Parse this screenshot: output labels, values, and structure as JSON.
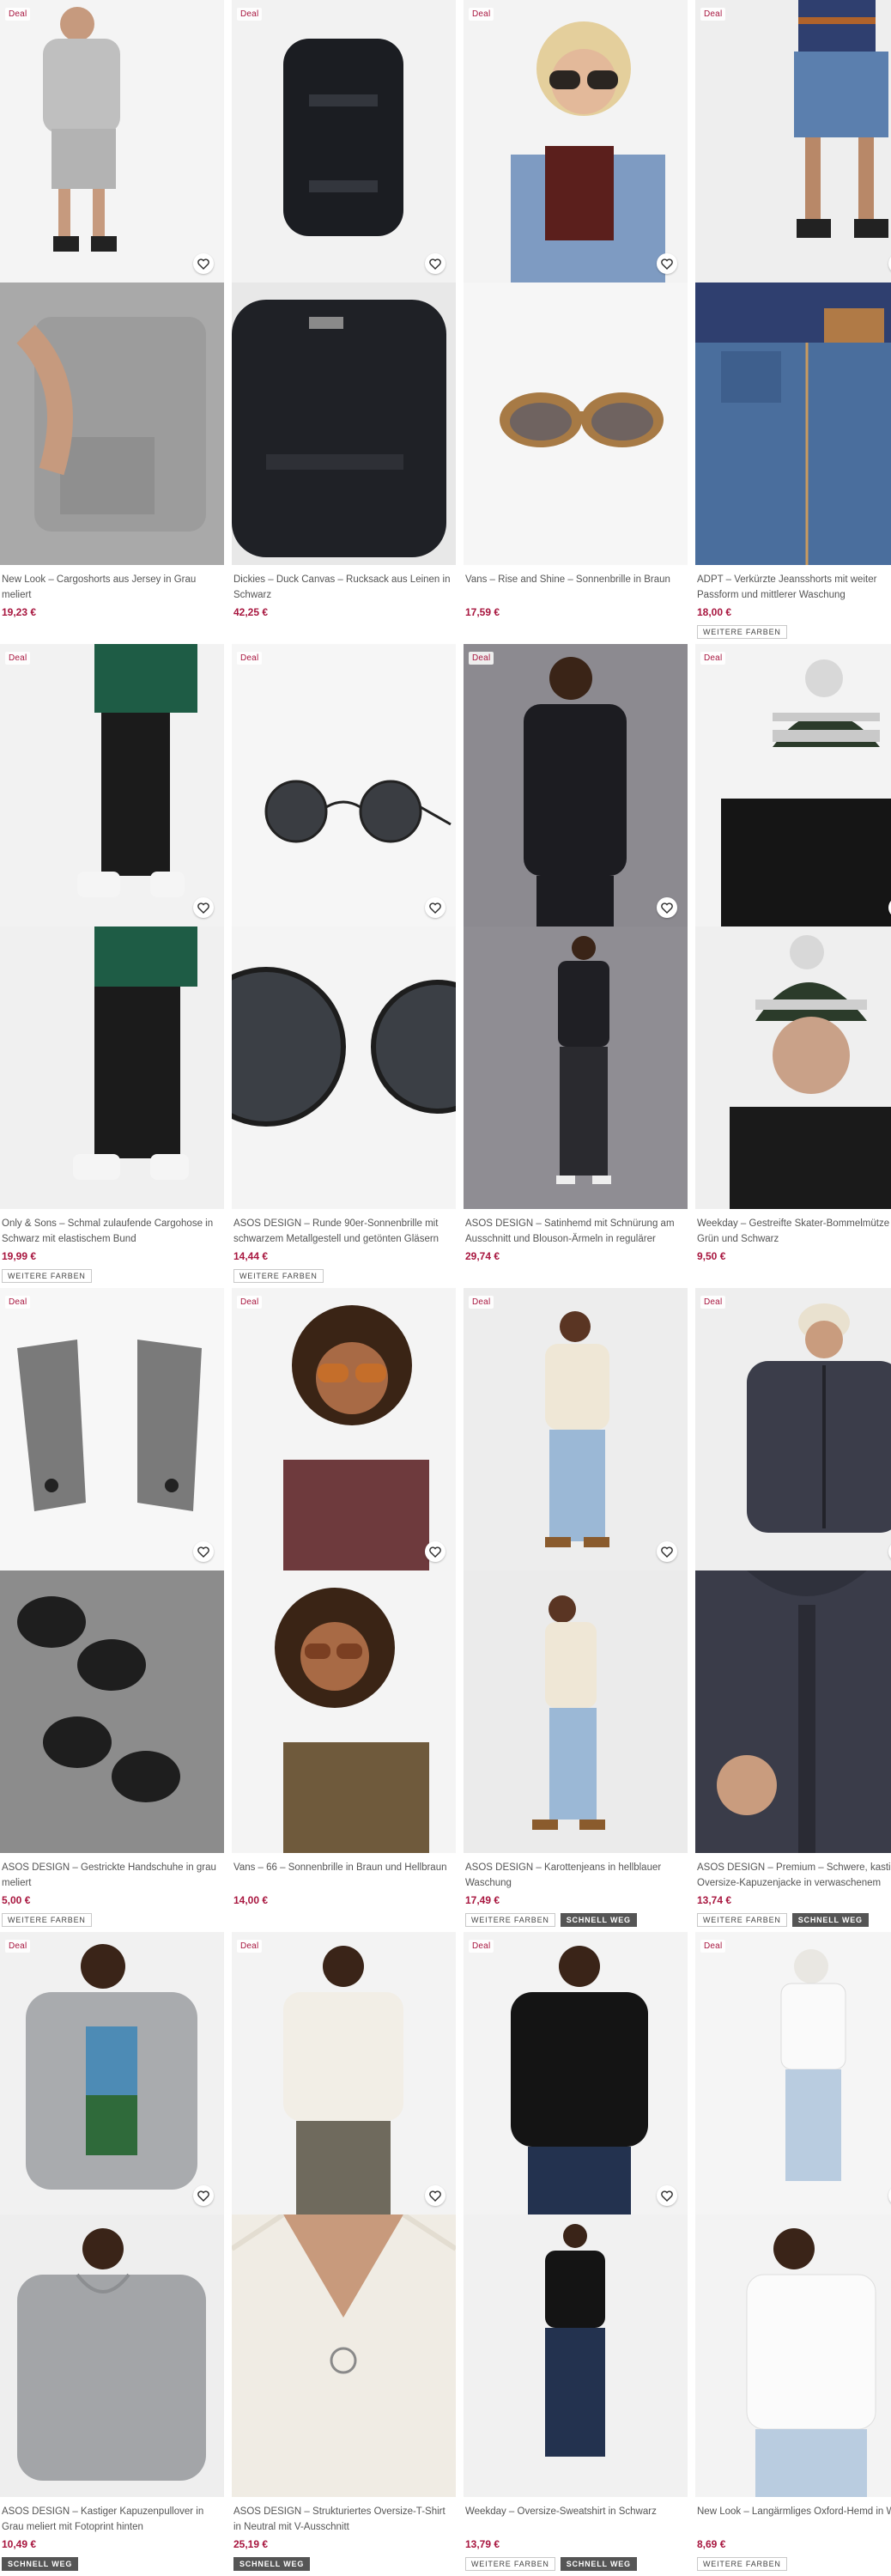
{
  "colors": {
    "price": "#a8163f",
    "deal": "#a8163f",
    "tag_dark": "#555555"
  },
  "icons": {
    "wishlist": "heart-icon"
  },
  "products": [
    {
      "deal": "Deal",
      "title": "New Look – Cargoshorts aus Jersey in Grau meliert",
      "price": "19,23 €",
      "tags": []
    },
    {
      "deal": "Deal",
      "title": "Dickies – Duck Canvas – Rucksack aus Leinen in Schwarz",
      "price": "42,25 €",
      "tags": []
    },
    {
      "deal": "Deal",
      "title": "Vans – Rise and Shine – Sonnenbrille in Braun",
      "price": "17,59 €",
      "tags": []
    },
    {
      "deal": "Deal",
      "title": "ADPT – Verkürzte Jeansshorts mit weiter Passform und mittlerer Waschung",
      "price": "18,00 €",
      "tags": [
        "WEITERE FARBEN"
      ]
    },
    {
      "deal": "Deal",
      "title": "Only & Sons – Schmal zulaufende Cargohose in Schwarz mit elastischem Bund",
      "price": "19,99 €",
      "tags": [
        "WEITERE FARBEN"
      ]
    },
    {
      "deal": "Deal",
      "title": "ASOS DESIGN – Runde 90er-Sonnenbrille mit schwarzem Metallgestell und getönten Gläsern",
      "price": "14,44 €",
      "tags": [
        "WEITERE FARBEN"
      ]
    },
    {
      "deal": "Deal",
      "title": "ASOS DESIGN – Satinhemd mit Schnürung am Ausschnitt und Blouson-Ärmeln in regulärer Passform",
      "price": "29,74 €",
      "tags": []
    },
    {
      "deal": "Deal",
      "title": "Weekday – Gestreifte Skater-Bommelmütze in Grün und Schwarz",
      "price": "9,50 €",
      "tags": []
    },
    {
      "deal": "Deal",
      "title": "ASOS DESIGN – Gestrickte Handschuhe in grau meliert",
      "price": "5,00 €",
      "tags": [
        "WEITERE FARBEN"
      ]
    },
    {
      "deal": "Deal",
      "title": "Vans – 66 – Sonnenbrille in Braun und Hellbraun",
      "price": "14,00 €",
      "tags": []
    },
    {
      "deal": "Deal",
      "title": "ASOS DESIGN – Karottenjeans in hellblauer Waschung",
      "price": "17,49 €",
      "tags": [
        "WEITERE FARBEN",
        "SCHNELL WEG"
      ]
    },
    {
      "deal": "Deal",
      "title": "ASOS DESIGN – Premium – Schwere, kastige Oversize-Kapuzenjacke in verwaschenem Schwarz",
      "price": "13,74 €",
      "tags": [
        "WEITERE FARBEN",
        "SCHNELL WEG"
      ]
    },
    {
      "deal": "Deal",
      "title": "ASOS DESIGN – Kastiger Kapuzenpullover in Grau meliert mit Fotoprint hinten",
      "price": "10,49 €",
      "tags": [
        "SCHNELL WEG"
      ]
    },
    {
      "deal": "Deal",
      "title": "ASOS DESIGN – Strukturiertes Oversize-T-Shirt in Neutral mit V-Ausschnitt",
      "price": "25,19 €",
      "tags": [
        "SCHNELL WEG"
      ]
    },
    {
      "deal": "Deal",
      "title": "Weekday – Oversize-Sweatshirt in Schwarz",
      "price": "13,79 €",
      "tags": [
        "WEITERE FARBEN",
        "SCHNELL WEG"
      ]
    },
    {
      "deal": "Deal",
      "title": "New Look – Langärmliges Oxford-Hemd in Weiß",
      "price": "8,69 €",
      "tags": [
        "WEITERE FARBEN"
      ]
    }
  ]
}
